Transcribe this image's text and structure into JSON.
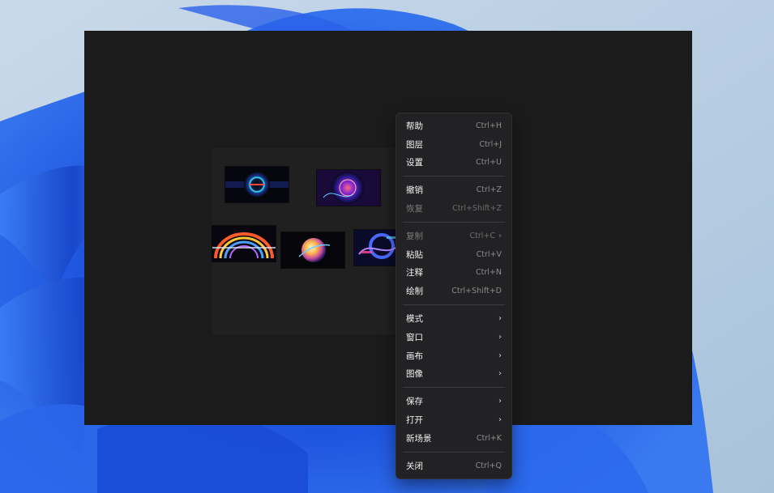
{
  "menu": {
    "groups": [
      [
        {
          "label": "帮助",
          "shortcut": "Ctrl+H"
        },
        {
          "label": "图层",
          "shortcut": "Ctrl+J"
        },
        {
          "label": "设置",
          "shortcut": "Ctrl+U"
        }
      ],
      [
        {
          "label": "撤销",
          "shortcut": "Ctrl+Z"
        },
        {
          "label": "恢复",
          "shortcut": "Ctrl+Shift+Z",
          "disabled": true
        }
      ],
      [
        {
          "label": "复制",
          "shortcut": "Ctrl+C",
          "disabled": true,
          "submenu": true
        },
        {
          "label": "粘贴",
          "shortcut": "Ctrl+V"
        },
        {
          "label": "注释",
          "shortcut": "Ctrl+N"
        },
        {
          "label": "绘制",
          "shortcut": "Ctrl+Shift+D"
        }
      ],
      [
        {
          "label": "模式",
          "shortcut": "",
          "submenu": true
        },
        {
          "label": "窗口",
          "shortcut": "",
          "submenu": true
        },
        {
          "label": "画布",
          "shortcut": "",
          "submenu": true
        },
        {
          "label": "图像",
          "shortcut": "",
          "submenu": true
        }
      ],
      [
        {
          "label": "保存",
          "shortcut": "",
          "submenu": true
        },
        {
          "label": "打开",
          "shortcut": "",
          "submenu": true
        },
        {
          "label": "新场景",
          "shortcut": "Ctrl+K"
        }
      ],
      [
        {
          "label": "关闭",
          "shortcut": "Ctrl+Q"
        }
      ]
    ],
    "submenu_glyph": "›"
  },
  "thumbnails": [
    {
      "name": "thumb-ring-portal",
      "kind": "ring"
    },
    {
      "name": "thumb-neon-vortex",
      "kind": "vortex"
    },
    {
      "name": "thumb-rainbow-arc",
      "kind": "arc"
    },
    {
      "name": "thumb-glow-sphere",
      "kind": "sphere"
    },
    {
      "name": "thumb-blue-abstract",
      "kind": "abstract"
    }
  ],
  "colors": {
    "window_bg": "#1b1b1b",
    "canvas_bg": "#202020",
    "menu_bg": "#222224",
    "menu_text": "#f2f2f2",
    "menu_shortcut": "#8c8c8c",
    "wallpaper_blue": "#1f4fd8"
  }
}
